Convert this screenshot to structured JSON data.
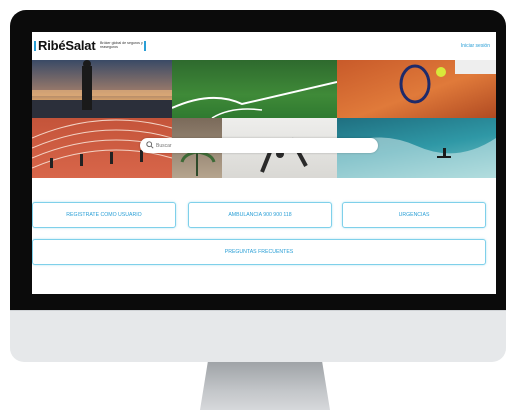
{
  "header": {
    "logo_name": "RibéSalat",
    "logo_tagline": "Bróker global de seguros y reaseguros",
    "login_link": "Iniciar sesión"
  },
  "search": {
    "placeholder": "Buscar"
  },
  "actions": {
    "register": "REGISTRATE COMO USUARIO",
    "ambulance": "AMBULANCIA 900 900 118",
    "emergencies": "URGENCIAS",
    "faq": "PREGUNTAS FRECUENTES"
  },
  "colors": {
    "accent": "#2a9fd6",
    "button_border": "#7fd0ea",
    "bezel": "#0b0b0b"
  }
}
